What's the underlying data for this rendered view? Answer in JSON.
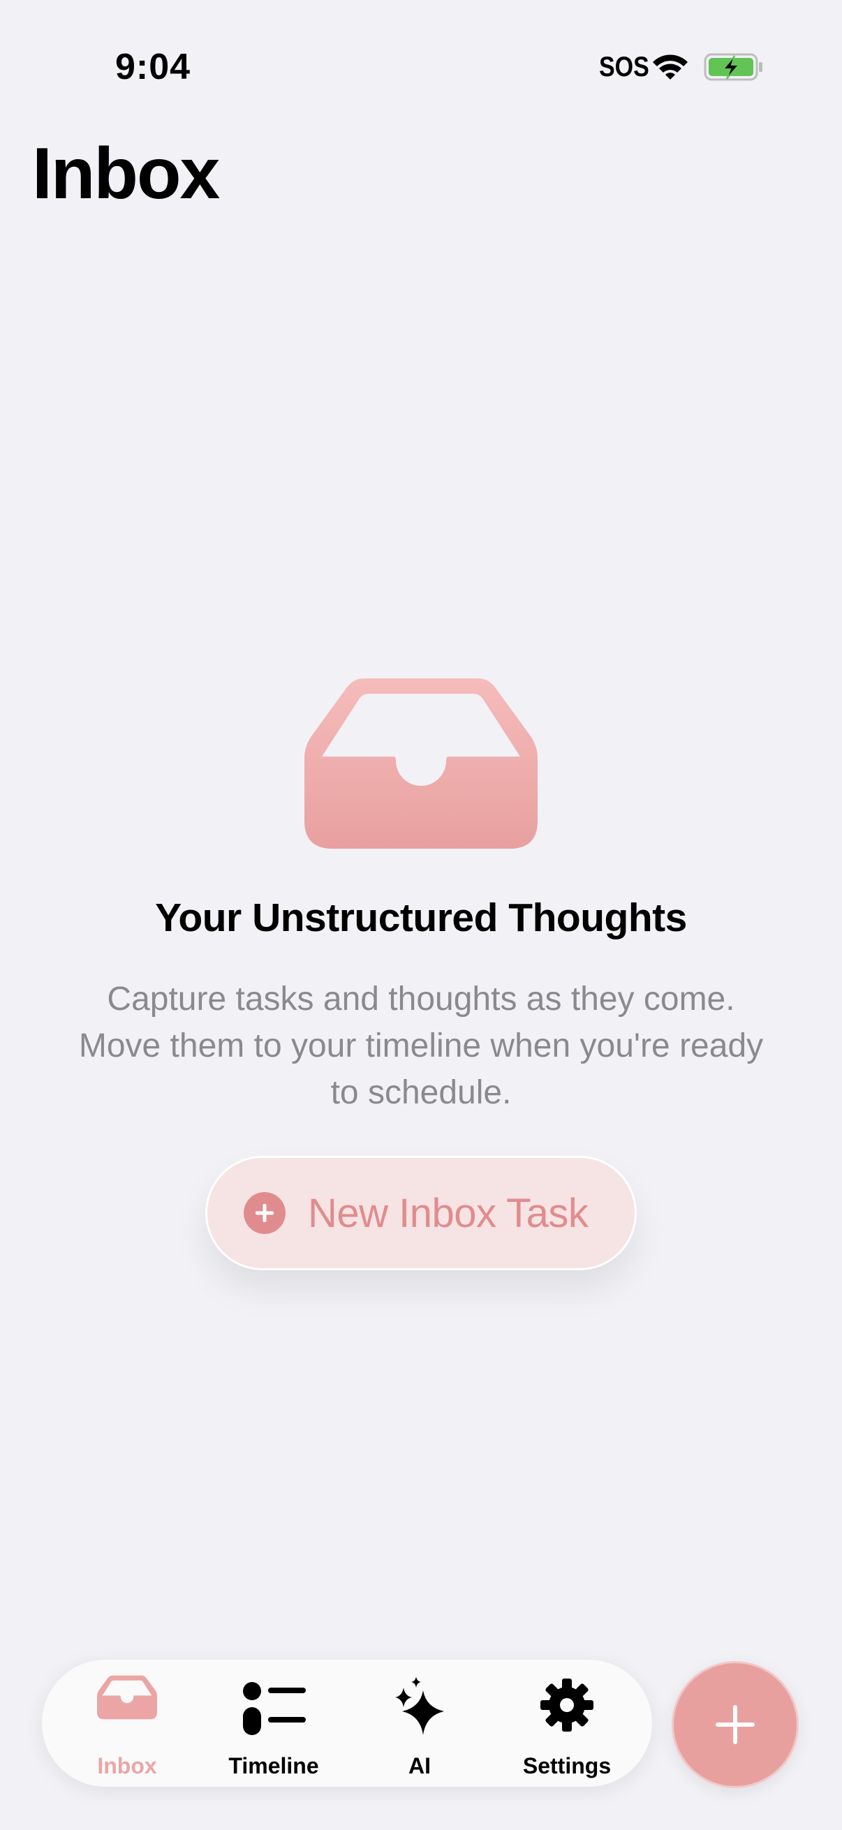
{
  "status_bar": {
    "time": "9:04",
    "carrier": "SOS",
    "icons": [
      "wifi-icon",
      "battery-charging-icon"
    ]
  },
  "header": {
    "title": "Inbox"
  },
  "empty_state": {
    "icon": "inbox-tray-icon",
    "title": "Your Unstructured Thoughts",
    "description": "Capture tasks and thoughts as they come. Move them to your timeline when you're ready to schedule.",
    "button_label": "New Inbox Task",
    "button_icon": "plus-circle-icon"
  },
  "tab_bar": {
    "tabs": [
      {
        "label": "Inbox",
        "icon": "inbox-tray-icon",
        "selected": true
      },
      {
        "label": "Timeline",
        "icon": "list-bullet-icon",
        "selected": false
      },
      {
        "label": "AI",
        "icon": "sparkles-icon",
        "selected": false
      },
      {
        "label": "Settings",
        "icon": "gear-icon",
        "selected": false
      }
    ]
  },
  "fab": {
    "icon": "plus-icon"
  },
  "colors": {
    "accent": "#e8a09f",
    "accent_text": "#e08c8e",
    "background": "#f2f2f6",
    "muted_text": "#8a8a8e"
  }
}
